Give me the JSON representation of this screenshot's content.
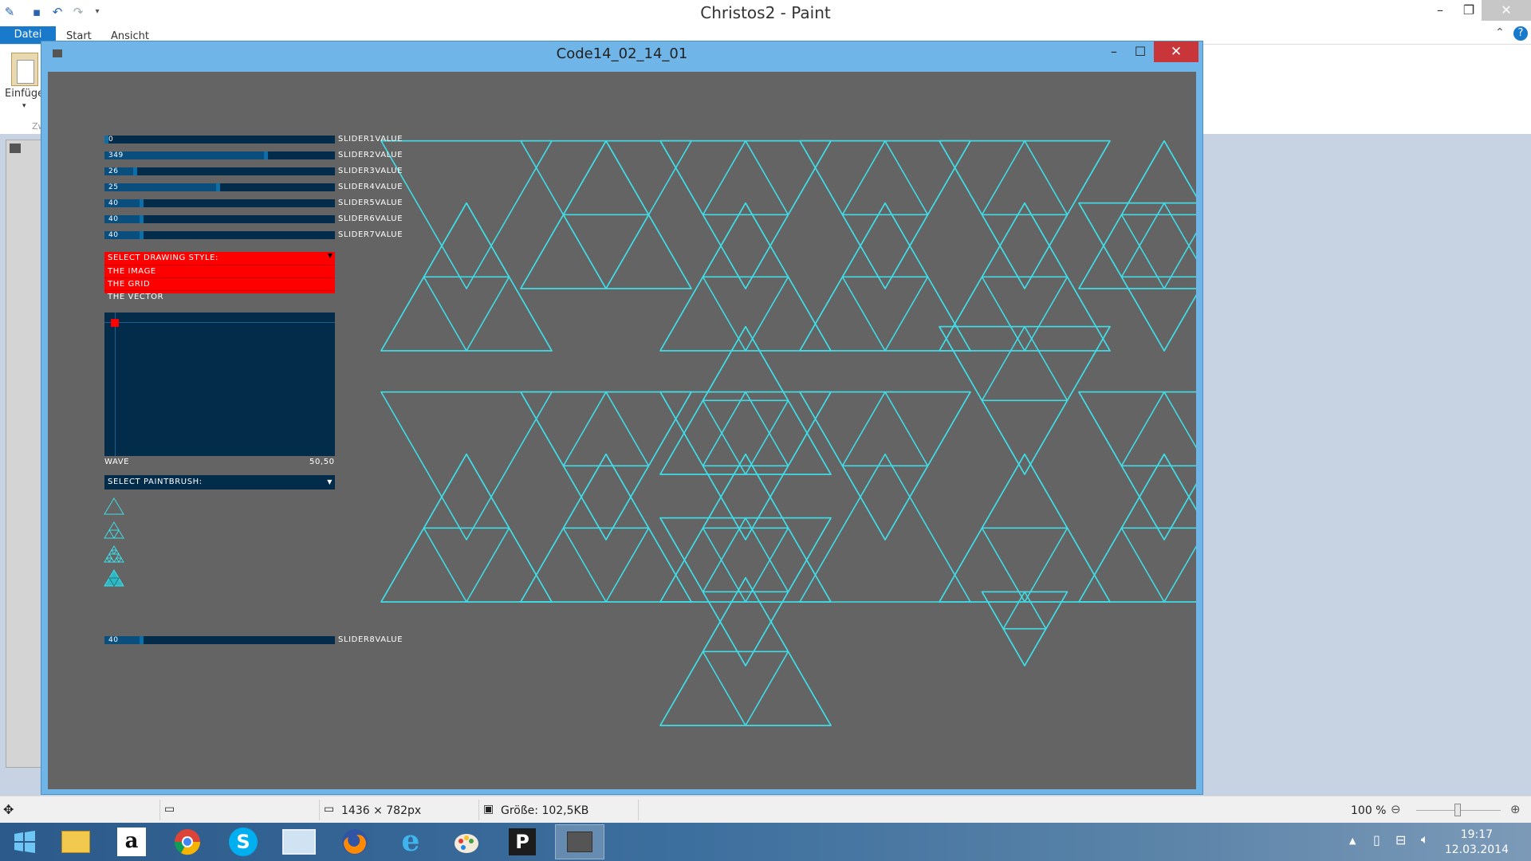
{
  "paint": {
    "title": "Christos2 - Paint",
    "tabs": [
      "Datei",
      "Start",
      "Ansicht"
    ],
    "ribbon": {
      "paste_label": "Einfüge",
      "group_label_partial": "Zw"
    },
    "status": {
      "dimensions": "1436 × 782px",
      "size": "Größe: 102,5KB",
      "zoom": "100 %"
    }
  },
  "sketch": {
    "title": "Code14_02_14_01",
    "sliders": [
      {
        "value": "0",
        "label": "SLIDER1VALUE",
        "level": 0.0
      },
      {
        "value": "349",
        "label": "SLIDER2VALUE",
        "level": 0.7
      },
      {
        "value": "26",
        "label": "SLIDER3VALUE",
        "level": 0.13
      },
      {
        "value": "25",
        "label": "SLIDER4VALUE",
        "level": 0.49
      },
      {
        "value": "40",
        "label": "SLIDER5VALUE",
        "level": 0.16
      },
      {
        "value": "40",
        "label": "SLIDER6VALUE",
        "level": 0.16
      },
      {
        "value": "40",
        "label": "SLIDER7VALUE",
        "level": 0.16
      }
    ],
    "drawing_style": {
      "header": "SELECT DRAWING STYLE:",
      "options": [
        "THE IMAGE",
        "THE GRID",
        "THE VECTOR"
      ]
    },
    "wave": {
      "label": "WAVE",
      "value": "50,50"
    },
    "paintbrush": {
      "header": "SELECT PAINTBRUSH:"
    },
    "slider8": {
      "value": "40",
      "label": "SLIDER8VALUE",
      "level": 0.16
    },
    "colors": {
      "stroke": "#3fdce6",
      "background": "#646464",
      "control": "#022c4a",
      "accent": "#ff0000"
    }
  },
  "taskbar": {
    "apps": [
      "start-icon",
      "explorer-icon",
      "amazon-icon",
      "chrome-icon",
      "skype-icon",
      "remote-desktop-icon",
      "firefox-icon",
      "ie-icon",
      "paint-icon",
      "processing-icon",
      "sketch-window-icon"
    ],
    "time": "19:17",
    "date": "12.03.2014"
  }
}
